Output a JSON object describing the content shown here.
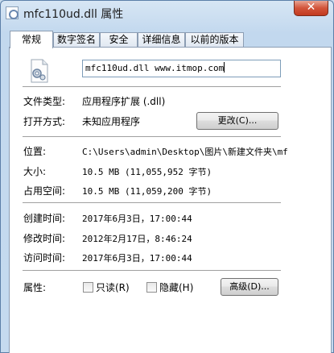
{
  "window": {
    "title": "mfc110ud.dll 属性",
    "close_glyph": "✕"
  },
  "tabs": [
    {
      "label": "常规"
    },
    {
      "label": "数字签名"
    },
    {
      "label": "安全"
    },
    {
      "label": "详细信息"
    },
    {
      "label": "以前的版本"
    }
  ],
  "general": {
    "file_name": "mfc110ud.dll www.itmop.com",
    "file_type_label": "文件类型:",
    "file_type_value": "应用程序扩展 (.dll)",
    "open_with_label": "打开方式:",
    "open_with_value": "未知应用程序",
    "change_button": "更改(C)...",
    "location_label": "位置:",
    "location_value": "C:\\Users\\admin\\Desktop\\图片\\新建文件夹\\mf",
    "size_label": "大小:",
    "size_value": "10.5 MB (11,055,952 字节)",
    "size_on_disk_label": "占用空间:",
    "size_on_disk_value": "10.5 MB (11,059,200 字节)",
    "created_label": "创建时间:",
    "created_value": "2017年6月3日，17:00:44",
    "modified_label": "修改时间:",
    "modified_value": "2012年2月17日，8:46:24",
    "accessed_label": "访问时间:",
    "accessed_value": "2017年6月3日，17:00:44",
    "attributes_label": "属性:",
    "readonly_label": "只读(R)",
    "readonly_checked": false,
    "hidden_label": "隐藏(H)",
    "hidden_checked": false,
    "advanced_button": "高级(D)..."
  },
  "icons": {
    "file_icon": "dll-gear-file-icon"
  }
}
